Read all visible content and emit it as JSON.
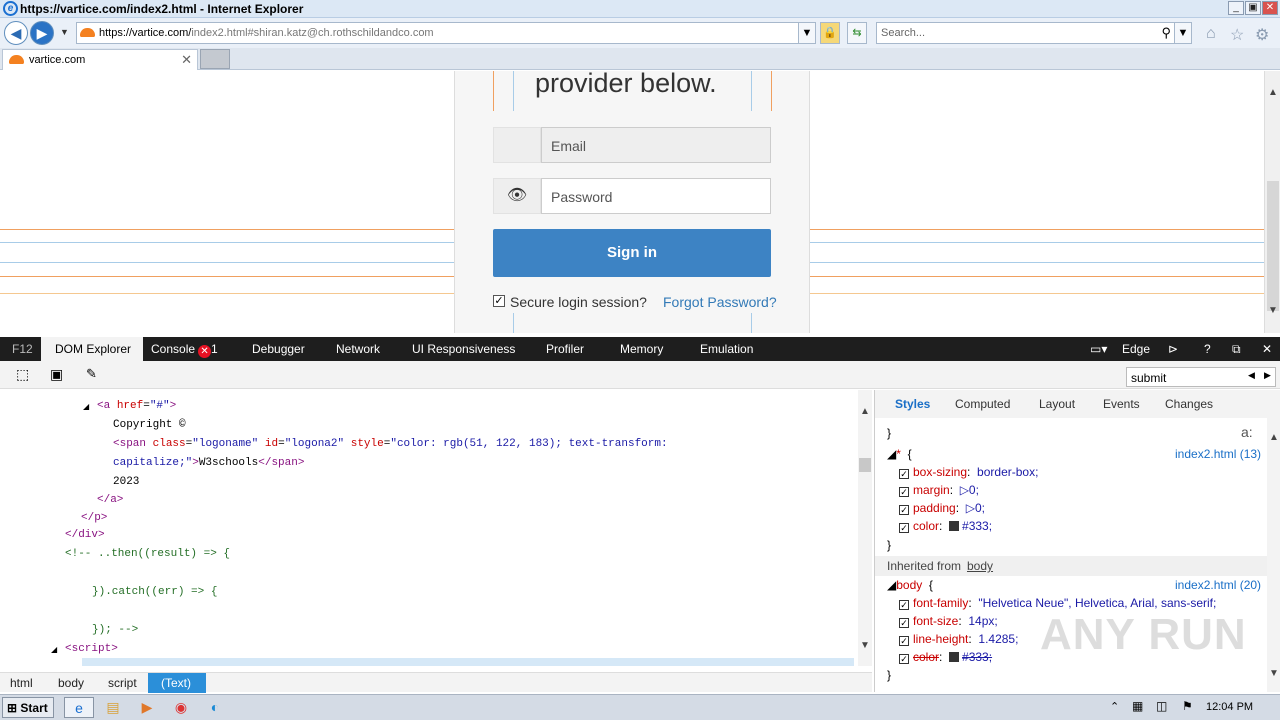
{
  "window": {
    "title": "https://vartice.com/index2.html - Internet Explorer",
    "min": "_",
    "restore": "▣",
    "close": "✕"
  },
  "nav": {
    "url_main": "https://vartice.com/",
    "url_rest": "index2.html#shiran.katz@ch.rothschildandco.com",
    "search_placeholder": "Search..."
  },
  "tabs": [
    {
      "label": "vartice.com"
    }
  ],
  "page": {
    "heading": "provider below.",
    "email_placeholder": "Email",
    "password_placeholder": "Password",
    "signin": "Sign in",
    "secure_label": "Secure login session?",
    "forgot": "Forgot Password?"
  },
  "devtools": {
    "tabs": [
      "F12",
      "DOM Explorer",
      "Console",
      "Debugger",
      "Network",
      "UI Responsiveness",
      "Profiler",
      "Memory",
      "Emulation"
    ],
    "console_errors": "1",
    "mode": "Edge",
    "find_value": "submit",
    "code_lines": [
      {
        "html": "<span class='tag'>&lt;a</span> <span class='attr'>href</span>=<span class='val'>\"#\"</span><span class='tag'>&gt;</span>"
      },
      {
        "html": "<span class='txt'>Copyright ©</span>"
      },
      {
        "html": "<span class='tag'>&lt;span</span> <span class='attr'>class</span>=<span class='val'>\"logoname\"</span> <span class='attr'>id</span>=<span class='val'>\"logona2\"</span> <span class='attr'>style</span>=<span class='val'>\"color: rgb(51, 122, 183); text-transform:</span>"
      },
      {
        "html": "<span class='val'>capitalize;\"</span><span class='tag'>&gt;</span>W3schools<span class='tag'>&lt;/span&gt;</span>"
      },
      {
        "html": "<span class='txt'>2023</span>"
      },
      {
        "html": "<span class='tag'>&lt;/a&gt;</span>"
      },
      {
        "html": "<span class='tag'>&lt;/p&gt;</span>"
      },
      {
        "html": "<span class='tag'>&lt;/div&gt;</span>"
      },
      {
        "html": "<span class='cmt'>&lt;!-- ..then((result) =&gt; {</span>"
      },
      {
        "html": "<span class='cmt'>}).catch((err) =&gt; {</span>"
      },
      {
        "html": "<span class='cmt'>}); --&gt;</span>"
      },
      {
        "html": "<span class='tag'>&lt;script&gt;</span>"
      }
    ],
    "breadcrumbs": [
      "html",
      "body",
      "script",
      "(Text)"
    ],
    "style_tabs": [
      "Styles",
      "Computed",
      "Layout",
      "Events",
      "Changes"
    ],
    "rules": {
      "star_selector": "*",
      "star_source": "index2.html (13)",
      "star_props": [
        {
          "name": "box-sizing",
          "value": "border-box;"
        },
        {
          "name": "margin",
          "value": "0;"
        },
        {
          "name": "padding",
          "value": "0;"
        },
        {
          "name": "color",
          "value": "#333;"
        }
      ],
      "inherited_label": "Inherited from",
      "inherited_from": "body",
      "body_selector": "body",
      "body_source": "index2.html (20)",
      "body_props": [
        {
          "name": "font-family",
          "value": "\"Helvetica Neue\", Helvetica, Arial, sans-serif;"
        },
        {
          "name": "font-size",
          "value": "14px;"
        },
        {
          "name": "line-height",
          "value": "1.4285;"
        },
        {
          "name": "color",
          "value": "#333;"
        }
      ]
    }
  },
  "taskbar": {
    "start": "Start",
    "clock": "12:04 PM"
  },
  "watermark": "ANY RUN",
  "colors": {
    "signin": "#3d83c4",
    "link": "#337ab7",
    "devtools_bar": "#1e1e1e",
    "crumb_active": "#2b8fd9"
  }
}
